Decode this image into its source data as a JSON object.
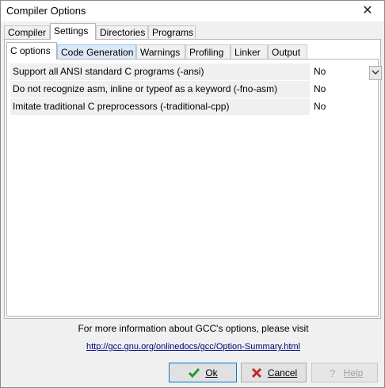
{
  "window": {
    "title": "Compiler Options"
  },
  "tabs": [
    {
      "label": "Compiler"
    },
    {
      "label": "Settings",
      "active": true
    },
    {
      "label": "Directories"
    },
    {
      "label": "Programs"
    }
  ],
  "subtabs": [
    {
      "label": "C options",
      "active": true
    },
    {
      "label": "Code Generation"
    },
    {
      "label": "Warnings"
    },
    {
      "label": "Profiling"
    },
    {
      "label": "Linker"
    },
    {
      "label": "Output"
    }
  ],
  "options": [
    {
      "label": "Support all ANSI standard C programs (-ansi)",
      "value": "No"
    },
    {
      "label": "Do not recognize asm, inline or typeof as a keyword (-fno-asm)",
      "value": "No"
    },
    {
      "label": "Imitate traditional C preprocessors (-traditional-cpp)",
      "value": "No"
    }
  ],
  "info": {
    "text": "For more information about GCC's options, please visit",
    "link": "http://gcc.gnu.org/onlinedocs/gcc/Option-Summary.html"
  },
  "buttons": {
    "ok": "Ok",
    "cancel": "Cancel",
    "help": "Help"
  },
  "colors": {
    "accent": "#0078d7",
    "check_green": "#1f9a2a",
    "cancel_red": "#c0282a"
  }
}
